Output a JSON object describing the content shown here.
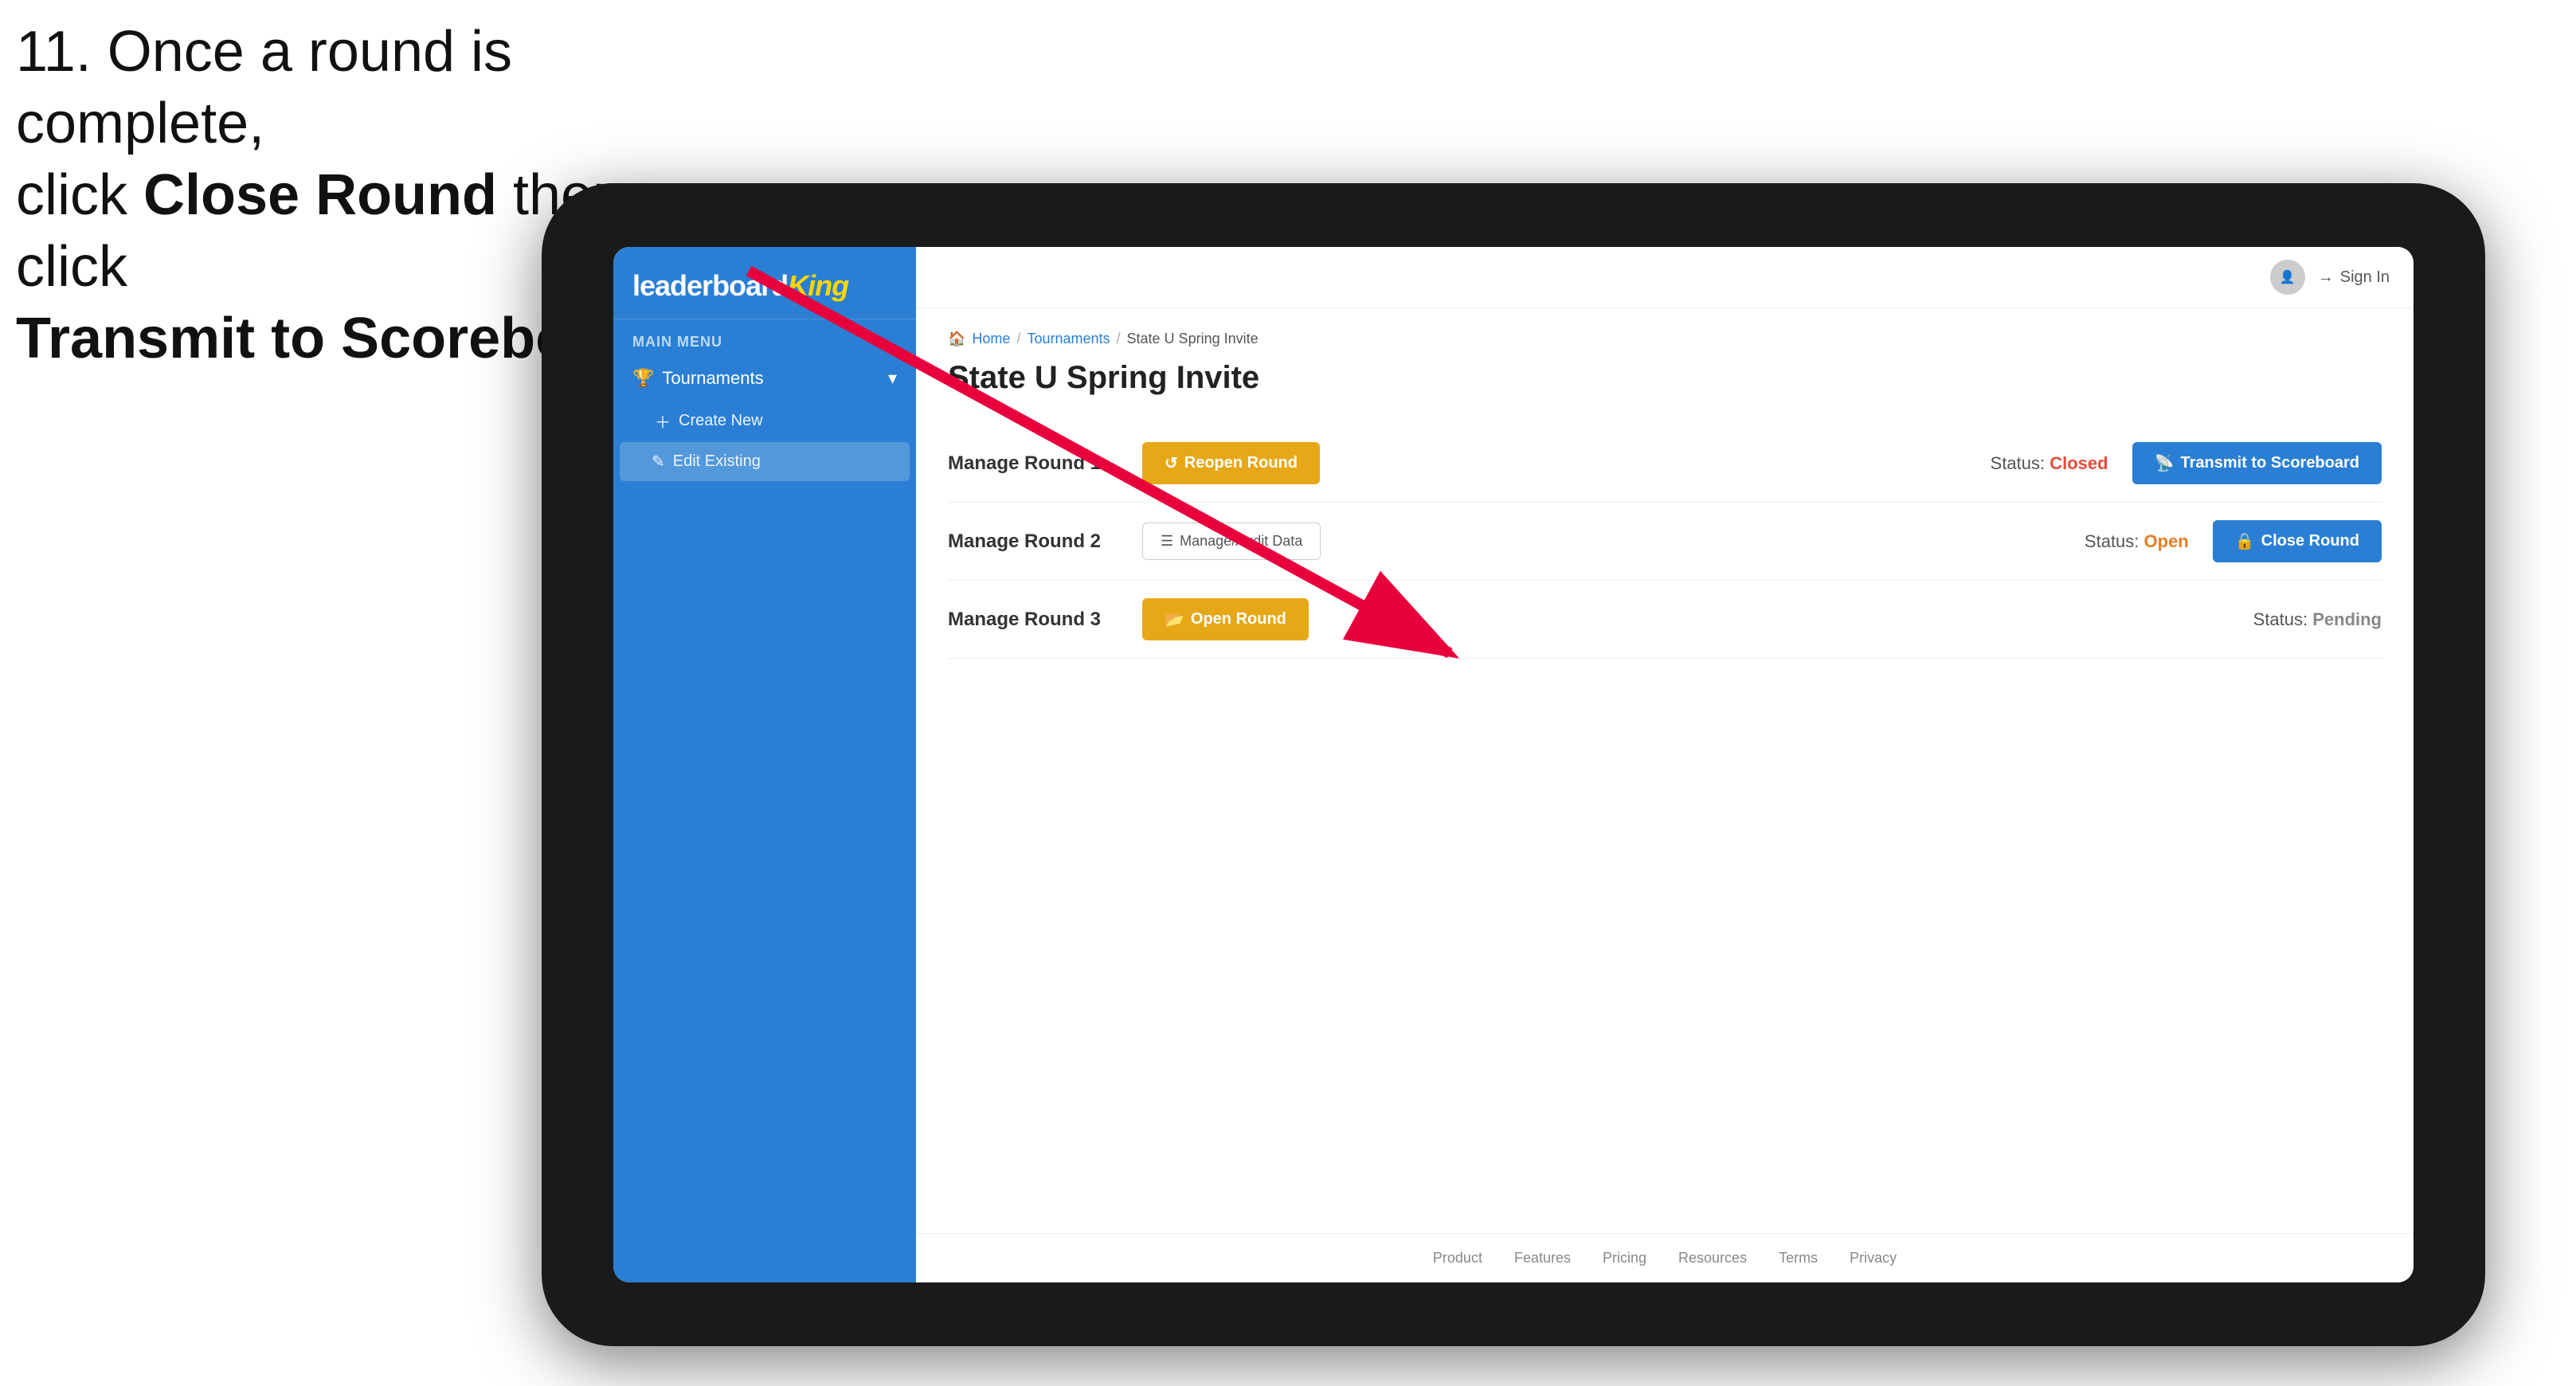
{
  "instruction": {
    "text_line1": "11. Once a round is complete,",
    "text_line2": "click ",
    "bold1": "Close Round",
    "text_line3": " then click",
    "bold2": "Transmit to Scoreboard."
  },
  "logo": {
    "part1": "leaderboard",
    "part2": "King"
  },
  "sidebar": {
    "main_menu_label": "MAIN MENU",
    "tournaments_label": "Tournaments",
    "create_new_label": "Create New",
    "edit_existing_label": "Edit Existing"
  },
  "topbar": {
    "sign_in_label": "Sign In"
  },
  "breadcrumb": {
    "home": "Home",
    "sep1": "/",
    "tournaments": "Tournaments",
    "sep2": "/",
    "current": "State U Spring Invite"
  },
  "page": {
    "title": "State U Spring Invite"
  },
  "rounds": [
    {
      "title": "Manage Round 1",
      "status_label": "Status:",
      "status_value": "Closed",
      "status_class": "closed",
      "button1_label": "Reopen Round",
      "button2_label": "Transmit to Scoreboard",
      "button2_type": "transmit"
    },
    {
      "title": "Manage Round 2",
      "status_label": "Status:",
      "status_value": "Open",
      "status_class": "open",
      "button1_label": "Manage/Audit Data",
      "button1_type": "manage",
      "button2_label": "Close Round",
      "button2_type": "close"
    },
    {
      "title": "Manage Round 3",
      "status_label": "Status:",
      "status_value": "Pending",
      "status_class": "pending",
      "button1_label": "Open Round",
      "button1_type": "open"
    }
  ],
  "footer": {
    "links": [
      "Product",
      "Features",
      "Pricing",
      "Resources",
      "Terms",
      "Privacy"
    ]
  }
}
